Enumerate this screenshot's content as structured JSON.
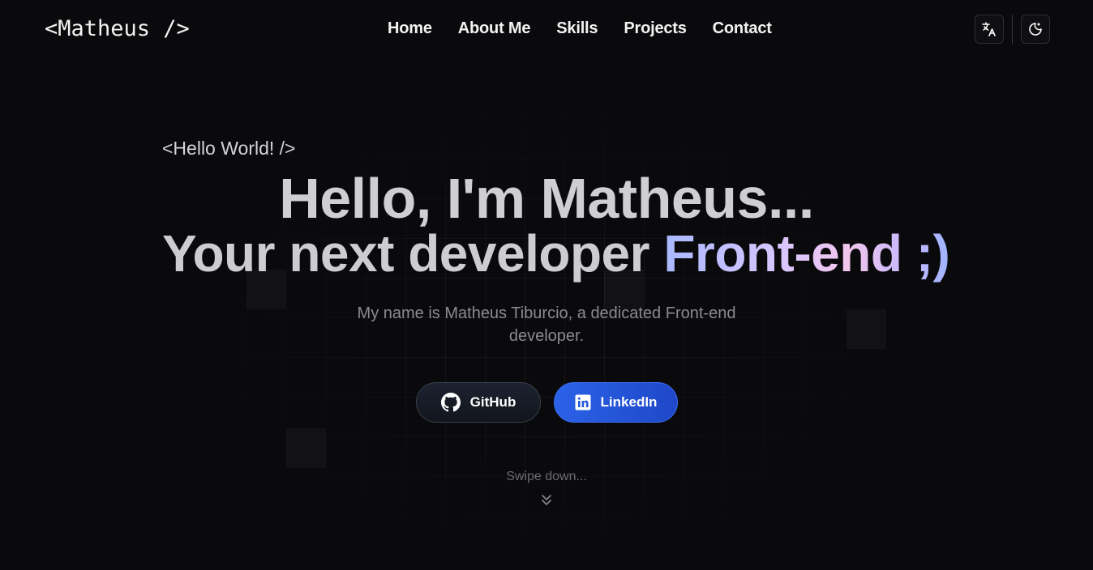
{
  "header": {
    "logo": "<Matheus />",
    "nav": [
      "Home",
      "About Me",
      "Skills",
      "Projects",
      "Contact"
    ]
  },
  "icons": {
    "translate": "translate-icon",
    "theme": "moon-icon",
    "github": "github-icon",
    "linkedin": "linkedin-icon",
    "scroll": "chevrons-down-icon"
  },
  "hero": {
    "tag": "<Hello World! />",
    "headline_line1": "Hello, I'm Matheus...",
    "headline_line2_plain": "Your next developer ",
    "headline_line2_highlight": "Front-end ;)",
    "subtitle": "My name is Matheus Tiburcio, a dedicated Front-end developer.",
    "buttons": {
      "github": "GitHub",
      "linkedin": "LinkedIn"
    },
    "swipe": "Swipe down..."
  },
  "colors": {
    "background": "#0a0a0c",
    "linkedin": "#2558e0",
    "highlight_gradient": [
      "#a9b8ff",
      "#f2c6ec",
      "#9fb4ff"
    ]
  }
}
